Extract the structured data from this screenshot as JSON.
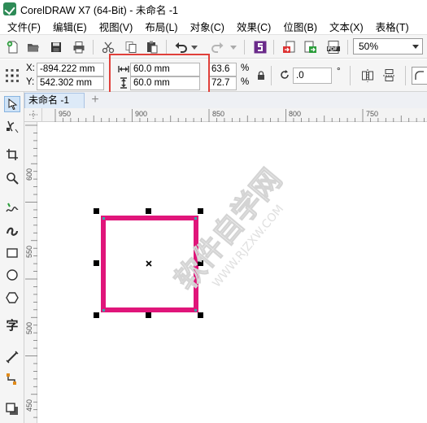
{
  "window": {
    "title": "CorelDRAW X7 (64-Bit) - 未命名 -1"
  },
  "menu": [
    {
      "label": "文件(F)"
    },
    {
      "label": "编辑(E)"
    },
    {
      "label": "视图(V)"
    },
    {
      "label": "布局(L)"
    },
    {
      "label": "对象(C)"
    },
    {
      "label": "效果(C)"
    },
    {
      "label": "位图(B)"
    },
    {
      "label": "文本(X)"
    },
    {
      "label": "表格(T)"
    }
  ],
  "toolbar": {
    "zoom": "50%",
    "icons": [
      "new-document-icon",
      "open-folder-icon",
      "save-icon",
      "print-icon",
      "cut-icon",
      "copy-icon",
      "paste-icon",
      "undo-icon",
      "redo-icon",
      "corel-connect-icon",
      "import-icon",
      "export-icon",
      "publish-pdf-icon"
    ]
  },
  "properties": {
    "x_label": "X:",
    "x_value": "-894.222 mm",
    "y_label": "Y:",
    "y_value": "542.302 mm",
    "width_value": "60.0 mm",
    "height_value": "60.0 mm",
    "scale_x": "63.6",
    "scale_y": "72.7",
    "percent": "%",
    "rotation_value": ".0",
    "degree_symbol": "°"
  },
  "document": {
    "tab_label": "未命名 -1",
    "add_tab": "+"
  },
  "ruler": {
    "horizontal_ticks": [
      "950",
      "900",
      "850",
      "800",
      "750"
    ],
    "vertical_ticks": [
      "600",
      "550",
      "500",
      "450"
    ]
  },
  "canvas": {
    "rectangle_stroke_color": "#e0157a",
    "watermark_text": "软件自学网",
    "watermark_url": "WWW.RJZXW.COM"
  },
  "toolbox": {
    "tools": [
      "pick-tool-icon",
      "shape-tool-icon",
      "crop-tool-icon",
      "zoom-tool-icon",
      "freehand-tool-icon",
      "artistic-media-tool-icon",
      "rectangle-tool-icon",
      "ellipse-tool-icon",
      "polygon-tool-icon",
      "text-tool-icon",
      "parallel-dimension-tool-icon",
      "connector-tool-icon",
      "drop-shadow-tool-icon"
    ],
    "text_tool_glyph": "字"
  }
}
